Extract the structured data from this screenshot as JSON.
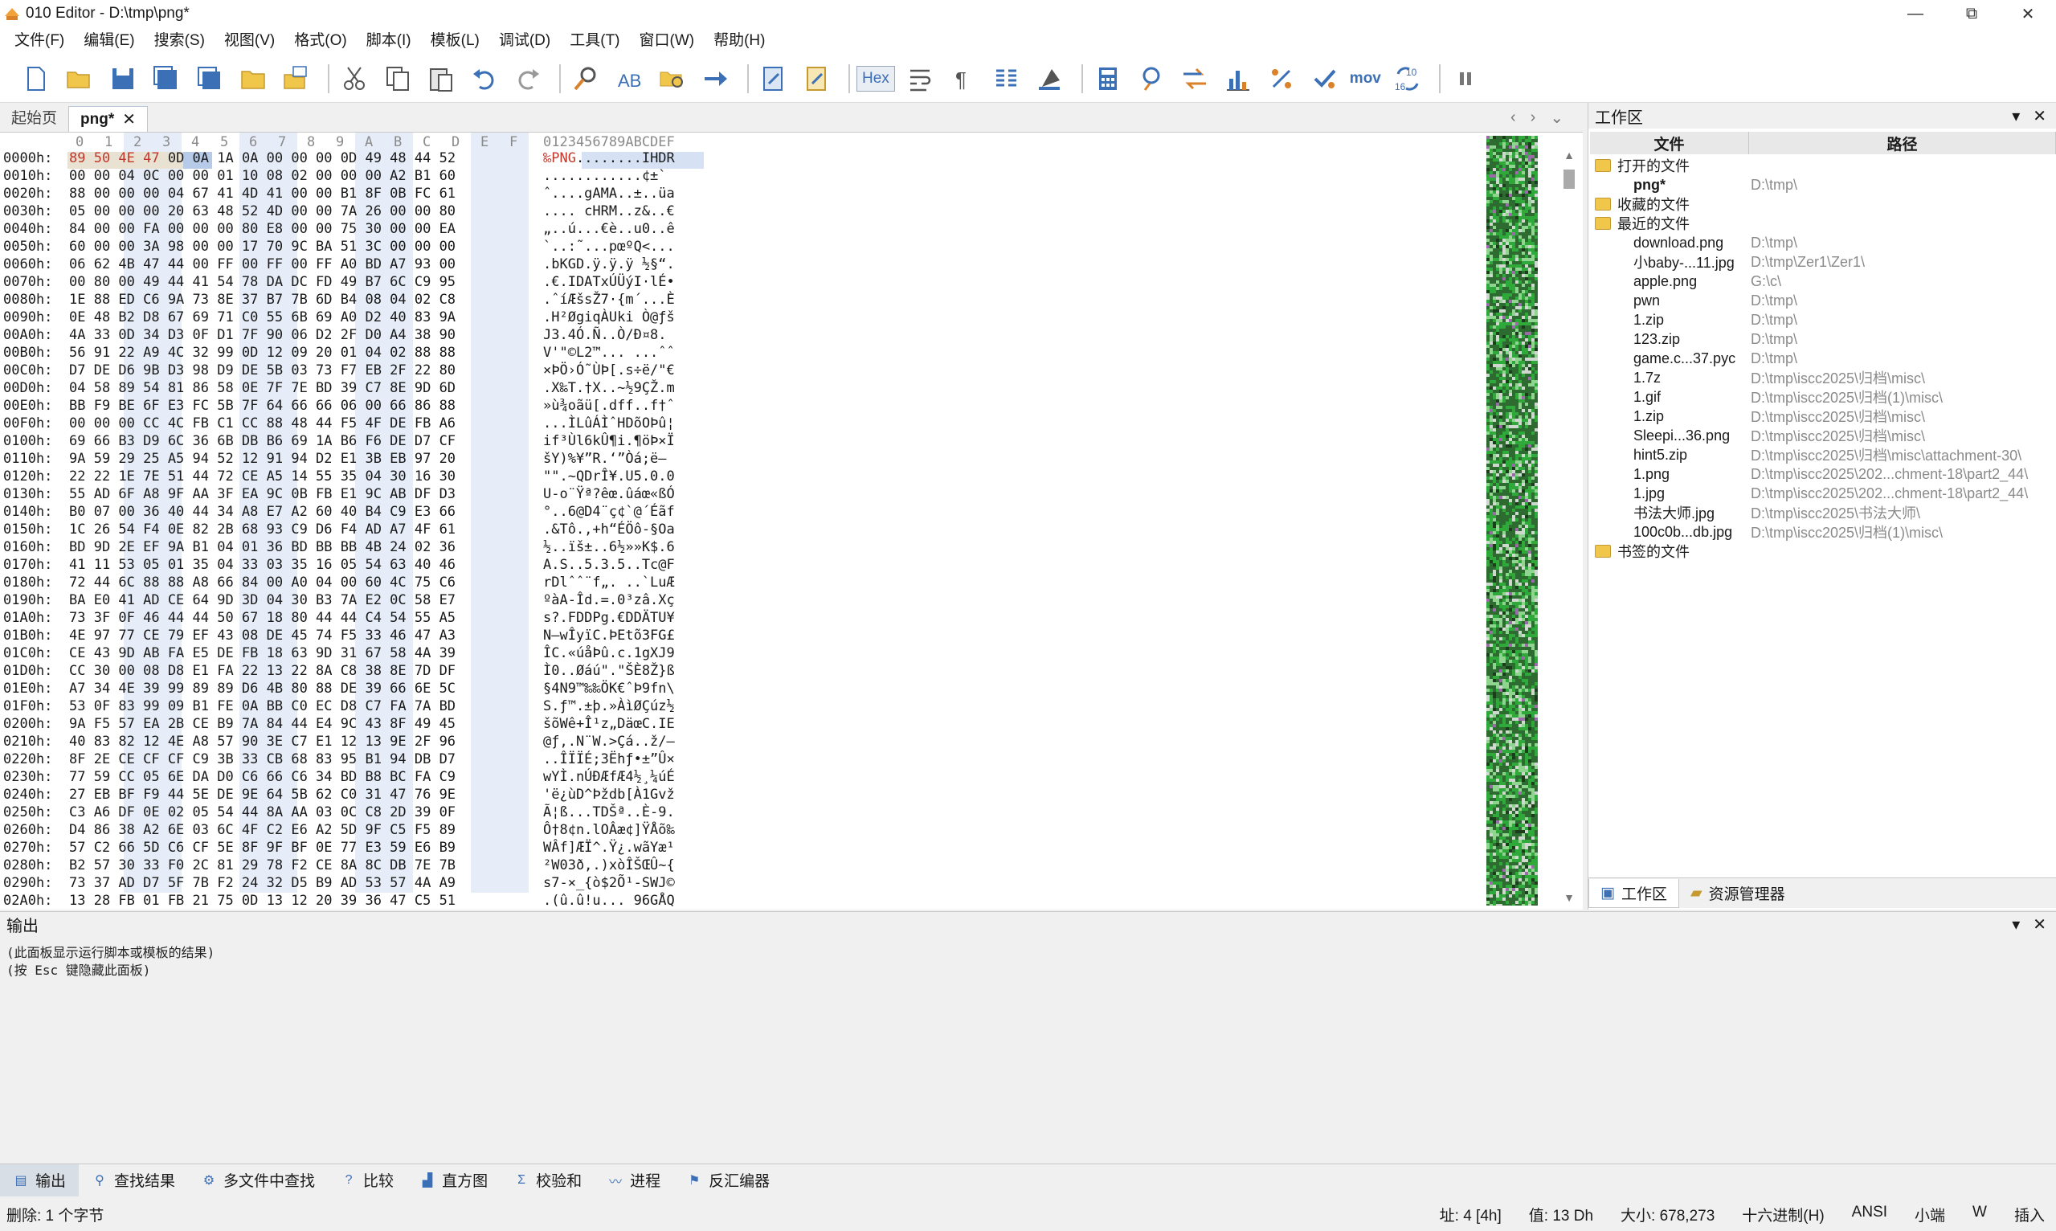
{
  "window": {
    "title": "010 Editor - D:\\tmp\\png*",
    "minimize": "—",
    "maximize": "⧉",
    "close": "✕"
  },
  "menu": [
    "文件(F)",
    "编辑(E)",
    "搜索(S)",
    "视图(V)",
    "格式(O)",
    "脚本(I)",
    "模板(L)",
    "调试(D)",
    "工具(T)",
    "窗口(W)",
    "帮助(H)"
  ],
  "toolbar": {
    "hex_label": "Hex",
    "mov_label": "mov",
    "icons": [
      "new-file-icon",
      "open-folder-icon",
      "save-icon",
      "save-as-icon",
      "save-all-icon",
      "folder-icon",
      "open-multiple-icon",
      "cut-icon",
      "copy-icon",
      "paste-icon",
      "undo-icon",
      "redo-icon",
      "find-icon",
      "replace-icon",
      "find-in-files-icon",
      "goto-icon",
      "run-script-icon",
      "run-template-icon",
      "hex-mode-icon",
      "word-wrap-icon",
      "paragraph-icon",
      "columns-icon",
      "highlight-icon",
      "calculator-icon",
      "inspector-icon",
      "compare-icon",
      "histogram-icon",
      "percent-icon",
      "checksum-icon",
      "mov-icon",
      "base-convert-icon",
      "pause-icon"
    ]
  },
  "editor_tabs": {
    "start": "起始页",
    "active": "png*"
  },
  "hex": {
    "header_cols": [
      "0",
      "1",
      "2",
      "3",
      "4",
      "5",
      "6",
      "7",
      "8",
      "9",
      "A",
      "B",
      "C",
      "D",
      "E",
      "F"
    ],
    "ascii_header": "0123456789ABCDEF",
    "rows": [
      {
        "addr": "0000h:",
        "bytes": "89 50 4E 47 0D 0A 1A 0A 00 00 00 0D 49 48 44 52",
        "ascii": "‰PNG........IHDR"
      },
      {
        "addr": "0010h:",
        "bytes": "00 00 04 0C 00 00 01 10 08 02 00 00 00 A2 B1 60",
        "ascii": "............¢±`"
      },
      {
        "addr": "0020h:",
        "bytes": "88 00 00 00 04 67 41 4D 41 00 00 B1 8F 0B FC 61",
        "ascii": "ˆ....gAMA..±..üa"
      },
      {
        "addr": "0030h:",
        "bytes": "05 00 00 00 20 63 48 52 4D 00 00 7A 26 00 00 80",
        "ascii": ".... cHRM..z&..€"
      },
      {
        "addr": "0040h:",
        "bytes": "84 00 00 FA 00 00 00 80 E8 00 00 75 30 00 00 EA",
        "ascii": "„..ú...€è..u0..ê"
      },
      {
        "addr": "0050h:",
        "bytes": "60 00 00 3A 98 00 00 17 70 9C BA 51 3C 00 00 00",
        "ascii": "`..:˜...pœºQ<..."
      },
      {
        "addr": "0060h:",
        "bytes": "06 62 4B 47 44 00 FF 00 FF 00 FF A0 BD A7 93 00",
        "ascii": ".bKGD.ÿ.ÿ.ÿ ½§“."
      },
      {
        "addr": "0070h:",
        "bytes": "00 80 00 49 44 41 54 78 DA DC FD 49 B7 6C C9 95",
        "ascii": ".€.IDATxÚÜýI·lÉ•"
      },
      {
        "addr": "0080h:",
        "bytes": "1E 88 ED C6 9A 73 8E 37 B7 7B 6D B4 08 04 02 C8",
        "ascii": ".ˆíÆšsŽ7·{m´...È"
      },
      {
        "addr": "0090h:",
        "bytes": "0E 48 B2 D8 67 69 71 C0 55 6B 69 A0 D2 40 83 9A",
        "ascii": ".H²ØgiqÀUki Ò@ƒš"
      },
      {
        "addr": "00A0h:",
        "bytes": "4A 33 0D 34 D3 0F D1 7F 90 06 D2 2F D0 A4 38 90",
        "ascii": "J3.4Ó.Ñ..Ò/Ð¤8."
      },
      {
        "addr": "00B0h:",
        "bytes": "56 91 22 A9 4C 32 99 0D 12 09 20 01 04 02 88 88",
        "ascii": "V'\"©L2™... ...ˆˆ"
      },
      {
        "addr": "00C0h:",
        "bytes": "D7 DE D6 9B D3 98 D9 DE 5B 03 73 F7 EB 2F 22 80",
        "ascii": "×ÞÖ›Ó˜ÙÞ[.s÷ë/\"€"
      },
      {
        "addr": "00D0h:",
        "bytes": "04 58 89 54 81 86 58 0E 7F 7E BD 39 C7 8E 9D 6D",
        "ascii": ".X‰T.†X..~½9ÇŽ.m"
      },
      {
        "addr": "00E0h:",
        "bytes": "BB F9 BE 6F E3 FC 5B 7F 64 66 66 06 00 66 86 88",
        "ascii": "»ù¾oãü[.dff..f†ˆ"
      },
      {
        "addr": "00F0h:",
        "bytes": "00 00 00 CC 4C FB C1 CC 88 48 44 F5 4F DE FB A6",
        "ascii": "...ÌLûÁÌˆHDõOÞû¦"
      },
      {
        "addr": "0100h:",
        "bytes": "69 66 B3 D9 6C 36 6B DB B6 69 1A B6 F6 DE D7 CF",
        "ascii": "if³Ùl6kÛ¶i.¶öÞ×Ï"
      },
      {
        "addr": "0110h:",
        "bytes": "9A 59 29 25 A5 94 52 12 91 94 D2 E1 3B EB 97 20",
        "ascii": "šY)%¥”R.‘”Òá;ë— "
      },
      {
        "addr": "0120h:",
        "bytes": "22 22 1E 7E 51 44 72 CE A5 14 55 35 04 30 16 30",
        "ascii": "\"\".~QDrÎ¥.U5.0.0"
      },
      {
        "addr": "0130h:",
        "bytes": "55 AD 6F A8 9F AA 3F EA 9C 0B FB E1 9C AB DF D3",
        "ascii": "U-o¨Ÿª?êœ.ûáœ«ßÓ"
      },
      {
        "addr": "0140h:",
        "bytes": "B0 07 00 36 40 44 34 A8 E7 A2 60 40 B4 C9 E3 66",
        "ascii": "°..6@D4¨ç¢`@´Éãf"
      },
      {
        "addr": "0150h:",
        "bytes": "1C 26 54 F4 0E 82 2B 68 93 C9 D6 F4 AD A7 4F 61",
        "ascii": ".&Tô.‚+h“ÉÖô-§Oa"
      },
      {
        "addr": "0160h:",
        "bytes": "BD 9D 2E EF 9A B1 04 01 36 BD BB BB 4B 24 02 36",
        "ascii": "½..ïš±..6½»»K$.6"
      },
      {
        "addr": "0170h:",
        "bytes": "41 11 53 05 01 35 04 33 03 35 16 05 54 63 40 46",
        "ascii": "A.S..5.3.5..Tc@F"
      },
      {
        "addr": "0180h:",
        "bytes": "72 44 6C 88 88 A8 66 84 00 A0 04 00 60 4C 75 C6",
        "ascii": "rDlˆˆ¨f„. ..`LuÆ"
      },
      {
        "addr": "0190h:",
        "bytes": "BA E0 41 AD CE 64 9D 3D 04 30 B3 7A E2 0C 58 E7",
        "ascii": "ºàA-Îd.=.0³zâ.Xç"
      },
      {
        "addr": "01A0h:",
        "bytes": "73 3F 0F 46 44 44 50 67 18 80 44 44 C4 54 55 A5",
        "ascii": "s?.FDDPg.€DDÄTU¥"
      },
      {
        "addr": "01B0h:",
        "bytes": "4E 97 77 CE 79 EF 43 08 DE 45 74 F5 33 46 47 A3",
        "ascii": "N—wÎyïC.ÞEtõ3FG£"
      },
      {
        "addr": "01C0h:",
        "bytes": "CE 43 9D AB FA E5 DE FB 18 63 9D 31 67 58 4A 39",
        "ascii": "ÎC.«úåÞû.c.1gXJ9"
      },
      {
        "addr": "01D0h:",
        "bytes": "CC 30 00 08 D8 E1 FA 22 13 22 8A C8 38 8E 7D DF",
        "ascii": "Ì0..Øáú\".\"ŠÈ8Ž}ß"
      },
      {
        "addr": "01E0h:",
        "bytes": "A7 34 4E 39 99 89 89 D6 4B 80 88 DE 39 66 6E 5C",
        "ascii": "§4N9™‰‰ÖK€ˆÞ9fn\\"
      },
      {
        "addr": "01F0h:",
        "bytes": "53 0F 83 99 09 B1 FE 0A BB C0 EC D8 C7 FA 7A BD",
        "ascii": "S.ƒ™.±þ.»ÀìØÇúz½"
      },
      {
        "addr": "0200h:",
        "bytes": "9A F5 57 EA 2B CE B9 7A 84 44 E4 9C 43 8F 49 45",
        "ascii": "šõWê+Î¹z„DäœC.IE"
      },
      {
        "addr": "0210h:",
        "bytes": "40 83 82 12 4E A8 57 90 3E C7 E1 12 13 9E 2F 96",
        "ascii": "@ƒ‚.N¨W.>Çá..ž/–"
      },
      {
        "addr": "0220h:",
        "bytes": "8F 2E CE CF CF C9 3B 33 CB 68 83 95 B1 94 DB D7",
        "ascii": "..ÎÏÏÉ;3Ëhƒ•±”Û×"
      },
      {
        "addr": "0230h:",
        "bytes": "77 59 CC 05 6E DA D0 C6 66 C6 34 BD B8 BC FA C9",
        "ascii": "wYÌ.nÚÐÆfÆ4½¸¼úÉ"
      },
      {
        "addr": "0240h:",
        "bytes": "27 EB BF F9 44 5E DE 9E 64 5B 62 C0 31 47 76 9E",
        "ascii": "'ë¿ùD^Þždb[À1Gvž"
      },
      {
        "addr": "0250h:",
        "bytes": "C3 A6 DF 0E 02 05 54 44 8A AA 03 0C C8 2D 39 0F",
        "ascii": "Ã¦ß...TDŠª..È-9."
      },
      {
        "addr": "0260h:",
        "bytes": "D4 86 38 A2 6E 03 6C 4F C2 E6 A2 5D 9F C5 F5 89",
        "ascii": "Ô†8¢n.lOÂæ¢]ŸÅõ‰"
      },
      {
        "addr": "0270h:",
        "bytes": "57 C2 66 5D C6 CF 5E 8F 9F BF 0E 77 E3 59 E6 B9",
        "ascii": "WÂf]ÆÏ^.Ÿ¿.wãYæ¹"
      },
      {
        "addr": "0280h:",
        "bytes": "B2 57 30 33 F0 2C 81 29 78 F2 CE 8A 8C DB 7E 7B",
        "ascii": "²W03ð,.)xòÎŠŒÛ~{"
      },
      {
        "addr": "0290h:",
        "bytes": "73 37 AD D7 5F 7B F2 24 32 D5 B9 AD 53 57 4A A9",
        "ascii": "s7-×_{ò$2Õ¹-SWJ©"
      },
      {
        "addr": "02A0h:",
        "bytes": "13 28 FB 01 FB 21 75 0D 13 12 20 39 36 47 C5 51",
        "ascii": ".(û.û!u... 96GÅQ"
      }
    ]
  },
  "workspace": {
    "title": "工作区",
    "col_file": "文件",
    "col_path": "路径",
    "groups": {
      "open": "打开的文件",
      "favorites": "收藏的文件",
      "recent": "最近的文件",
      "bookmarked": "书签的文件"
    },
    "open_files": [
      {
        "name": "png*",
        "path": "D:\\tmp\\"
      }
    ],
    "recent_files": [
      {
        "name": "download.png",
        "path": "D:\\tmp\\"
      },
      {
        "name": "小baby-...11.jpg",
        "path": "D:\\tmp\\Zer1\\Zer1\\"
      },
      {
        "name": "apple.png",
        "path": "G:\\c\\"
      },
      {
        "name": "pwn",
        "path": "D:\\tmp\\"
      },
      {
        "name": "1.zip",
        "path": "D:\\tmp\\"
      },
      {
        "name": "123.zip",
        "path": "D:\\tmp\\"
      },
      {
        "name": "game.c...37.pyc",
        "path": "D:\\tmp\\"
      },
      {
        "name": "1.7z",
        "path": "D:\\tmp\\iscc2025\\归档\\misc\\"
      },
      {
        "name": "1.gif",
        "path": "D:\\tmp\\iscc2025\\归档(1)\\misc\\"
      },
      {
        "name": "1.zip",
        "path": "D:\\tmp\\iscc2025\\归档\\misc\\"
      },
      {
        "name": "Sleepi...36.png",
        "path": "D:\\tmp\\iscc2025\\归档\\misc\\"
      },
      {
        "name": "hint5.zip",
        "path": "D:\\tmp\\iscc2025\\归档\\misc\\attachment-30\\"
      },
      {
        "name": "1.png",
        "path": "D:\\tmp\\iscc2025\\202...chment-18\\part2_44\\"
      },
      {
        "name": "1.jpg",
        "path": "D:\\tmp\\iscc2025\\202...chment-18\\part2_44\\"
      },
      {
        "name": "书法大师.jpg",
        "path": "D:\\tmp\\iscc2025\\书法大师\\"
      },
      {
        "name": "100c0b...db.jpg",
        "path": "D:\\tmp\\iscc2025\\归档(1)\\misc\\"
      }
    ],
    "tab_workspace": "工作区",
    "tab_explorer": "资源管理器"
  },
  "output": {
    "title": "输出",
    "lines": [
      "(此面板显示运行脚本或模板的结果)",
      "(按 Esc 键隐藏此面板)"
    ]
  },
  "bottom_tabs": [
    "输出",
    "查找结果",
    "多文件中查找",
    "比较",
    "直方图",
    "校验和",
    "进程",
    "反汇编器"
  ],
  "status": {
    "left": "删除: 1 个字节",
    "address": "址: 4 [4h]",
    "value": "值: 13 Dh",
    "size": "大小: 678,273",
    "mode": "十六进制(H)",
    "encoding": "ANSI",
    "endian": "小端",
    "w": "W",
    "insert": "插入"
  },
  "colors": {
    "accent": "#3b6fb6",
    "signature_red": "#c0392b",
    "overview_green": "#2faa3a"
  }
}
